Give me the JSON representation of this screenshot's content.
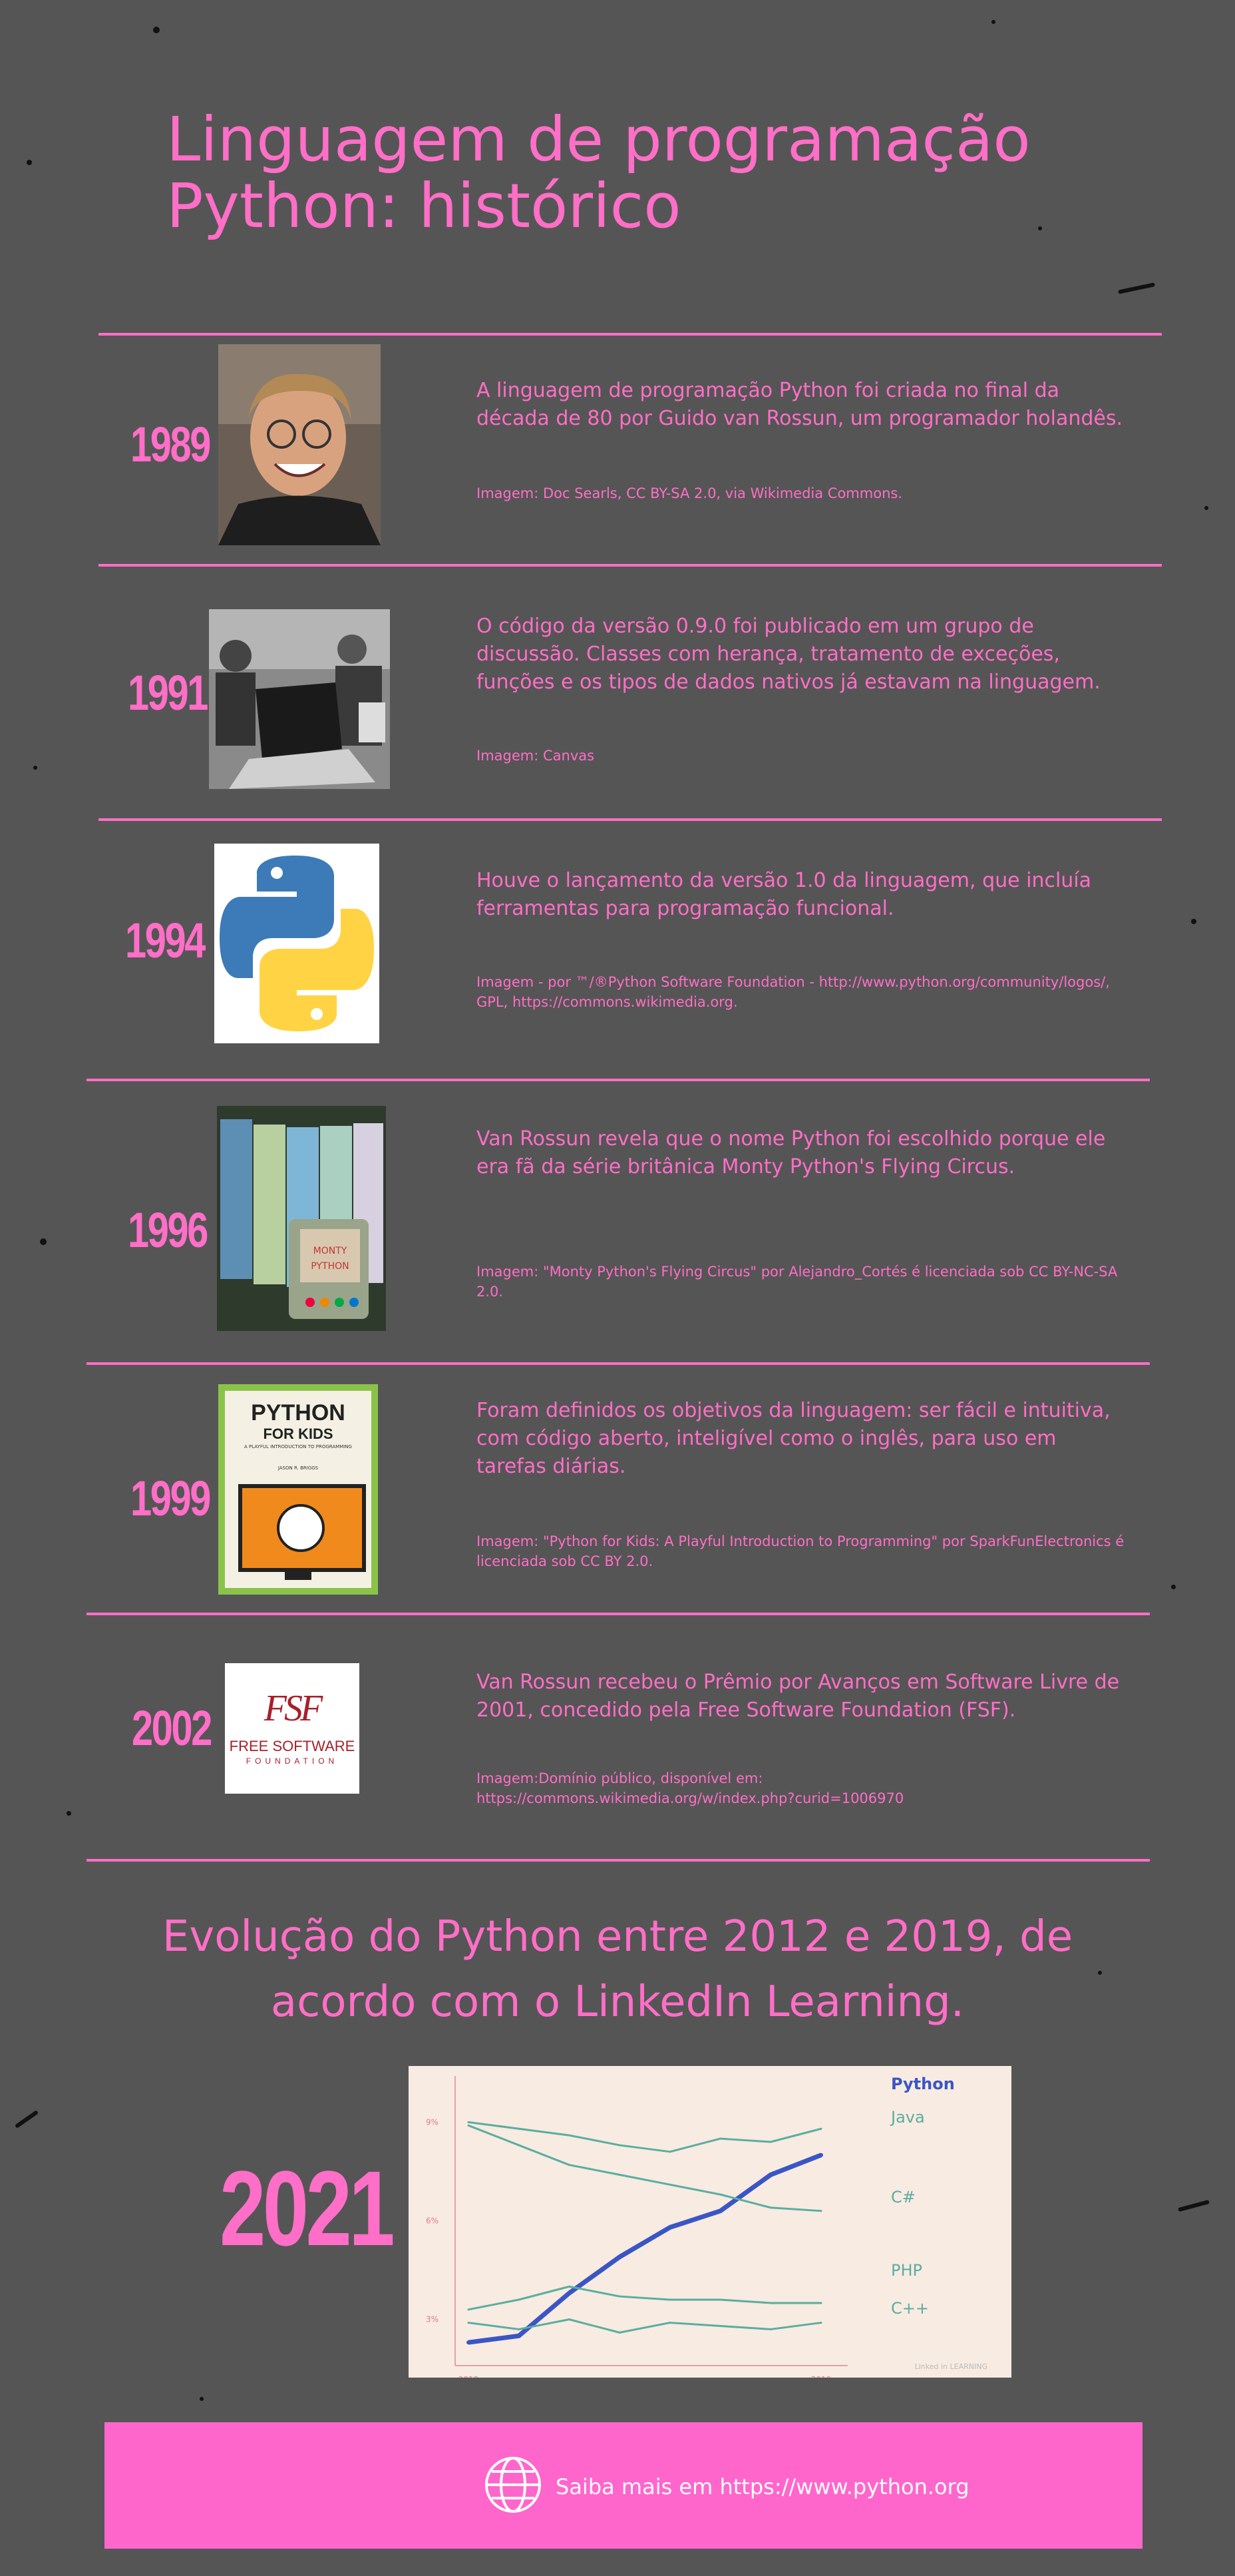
{
  "title": "Linguagem de programação Python: histórico",
  "timeline": [
    {
      "year": "1989",
      "text": "A linguagem de programação Python foi criada no final da década de 80 por Guido van Rossun, um programador holandês.",
      "credit": "Imagem: Doc Searls, CC BY-SA 2.0,  via Wikimedia Commons.",
      "image": "portrait-photo"
    },
    {
      "year": "1991",
      "text": "O código  da  versão 0.9.0 foi publicado em um grupo de discussão.  Classes com herança, tratamento de exceções, funções e os tipos de dados nativos já estavam na linguagem.",
      "credit": "Imagem: Canvas",
      "image": "laptop-meeting-photo"
    },
    {
      "year": "1994",
      "text": "Houve o lançamento da versão 1.0 da linguagem,  que incluía ferramentas para programação funcional.",
      "credit": "Imagem - por ™/®Python Software Foundation - http://www.python.org/community/logos/, GPL, https://commons.wikimedia.org.",
      "image": "python-logo"
    },
    {
      "year": "1996",
      "text": "Van Rossun revela que o nome Python foi escolhido porque ele era fã da série britânica Monty Python's Flying Circus.",
      "credit": "Imagem: \"Monty Python's Flying Circus\"  por Alejandro_Cortés é licenciada sob  CC BY-NC-SA 2.0.",
      "image": "monty-python-dvds-photo"
    },
    {
      "year": "1999",
      "text": "Foram definidos os objetivos da linguagem: ser fácil e intuitiva, com código aberto,  inteligível como o inglês,  para uso em tarefas diárias.",
      "credit": "Imagem: \"Python for Kids: A Playful Introduction to Programming\"  por SparkFunElectronics é licenciada sob CC BY 2.0.",
      "image": "python-for-kids-book",
      "book": {
        "title": "PYTHON",
        "title2": "FOR KIDS",
        "subtitle": "A PLAYFUL INTRODUCTION TO PROGRAMMING",
        "author": "JASON R. BRIGGS"
      }
    },
    {
      "year": "2002",
      "text": "Van Rossun recebeu o Prêmio por Avanços em Software Livre de 2001,  concedido pela Free Software Foundation (FSF).",
      "credit": "Imagem:Domínio público, disponível em: https://commons.wikimedia.org/w/index.php?curid=1006970",
      "image": "fsf-logo",
      "logo": {
        "mark": "FSF",
        "line1": "FREE SOFTWARE",
        "line2": "FOUNDATION"
      }
    }
  ],
  "evolution_heading": "Evolução do Python entre 2012 e 2019, de acordo com o LinkedIn Learning.",
  "year_2021": "2021",
  "chart_data": {
    "type": "line",
    "title": "",
    "xlabel": "",
    "ylabel": "",
    "x": [
      2012,
      2013,
      2014,
      2015,
      2016,
      2017,
      2018,
      2019
    ],
    "x_tick_labels": [
      "2012",
      "2019"
    ],
    "y_tick_labels": [
      "9%",
      "6%",
      "3%"
    ],
    "ylim": [
      2,
      10
    ],
    "series": [
      {
        "name": "Python",
        "color": "#3a56c4",
        "values": [
          2.3,
          2.5,
          3.8,
          4.9,
          5.8,
          6.3,
          7.4,
          8.0
        ]
      },
      {
        "name": "Java",
        "color": "#5aaea0",
        "values": [
          9.0,
          8.8,
          8.6,
          8.3,
          8.1,
          8.5,
          8.4,
          8.8
        ]
      },
      {
        "name": "C#",
        "color": "#5aaea0",
        "values": [
          8.9,
          8.3,
          7.7,
          7.4,
          7.1,
          6.8,
          6.4,
          6.3
        ]
      },
      {
        "name": "PHP",
        "color": "#5aaea0",
        "values": [
          3.3,
          3.6,
          4.0,
          3.7,
          3.6,
          3.6,
          3.5,
          3.5
        ]
      },
      {
        "name": "C++",
        "color": "#5aaea0",
        "values": [
          2.9,
          2.7,
          3.0,
          2.6,
          2.9,
          2.8,
          2.7,
          2.9
        ]
      }
    ],
    "watermark": "Linked in LEARNING"
  },
  "footer": {
    "text": "Saiba mais em https://www.python.org",
    "icon": "globe-icon"
  },
  "colors": {
    "background": "#555555",
    "accent": "#ff6ec7",
    "footer": "#ff66cc",
    "chart_bg": "#f8ebe2",
    "python_line": "#3a56c4",
    "other_lines": "#5aaea0"
  }
}
